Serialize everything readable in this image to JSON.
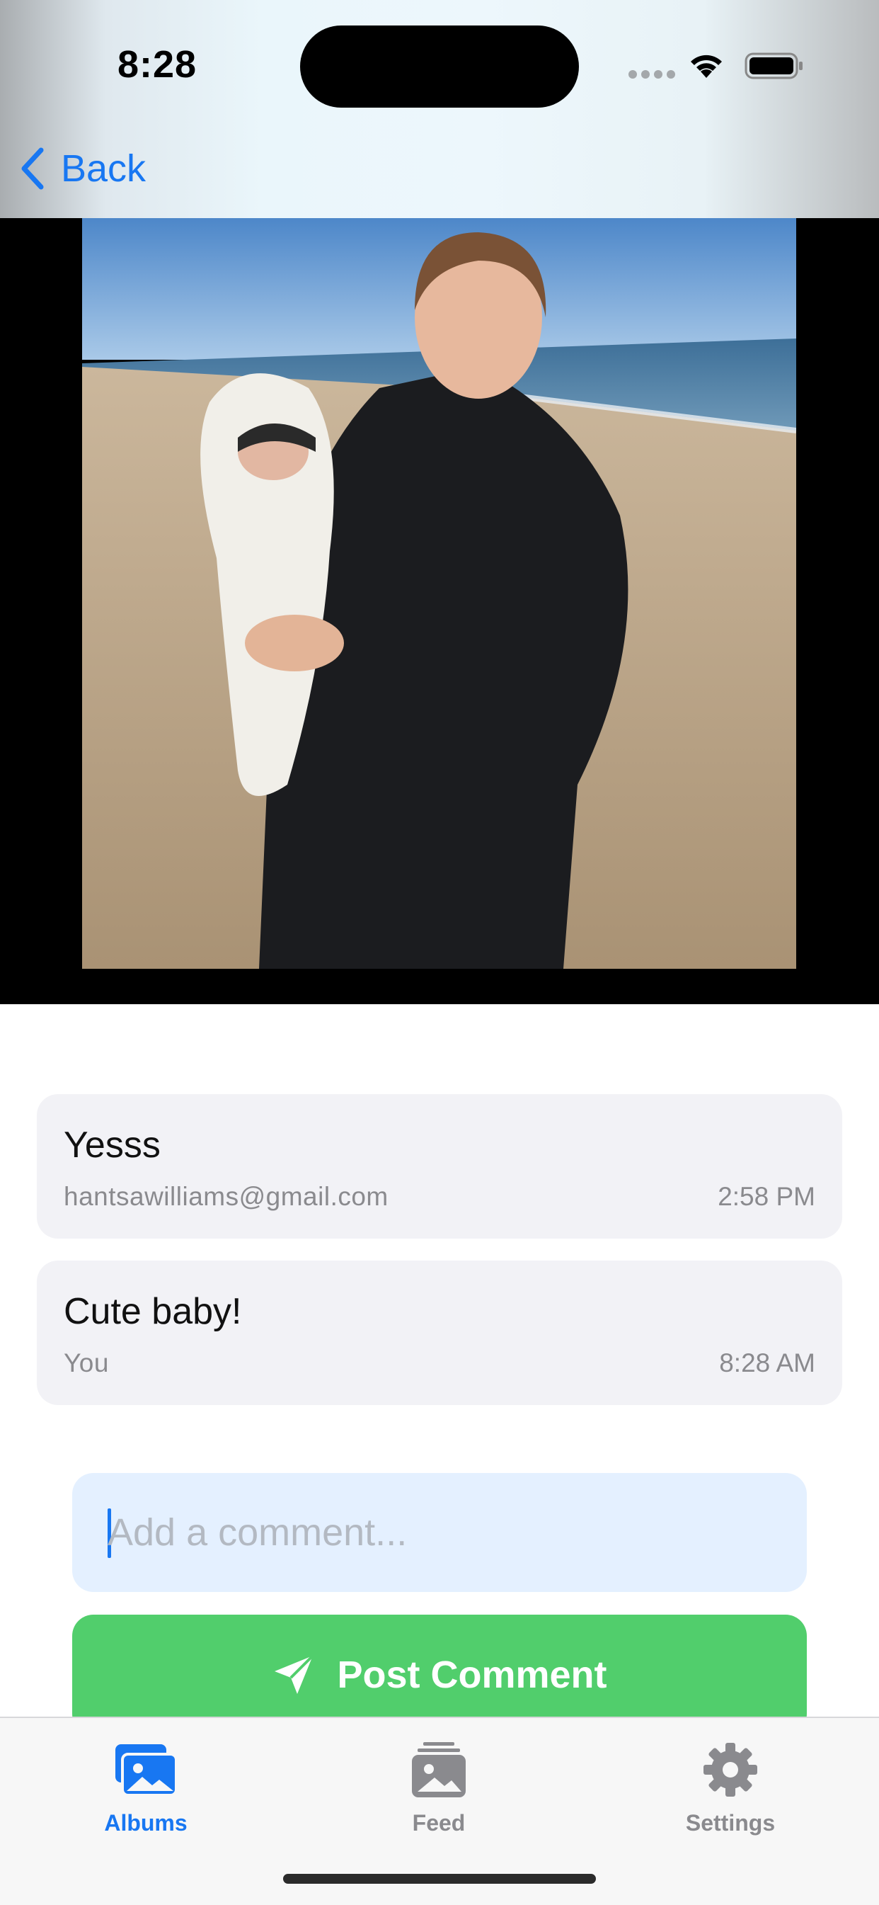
{
  "status_bar": {
    "time": "8:28"
  },
  "nav": {
    "back_label": "Back"
  },
  "comments": [
    {
      "text": "Yesss",
      "author": "hantsawilliams@gmail.com",
      "time": "2:58 PM"
    },
    {
      "text": "Cute baby!",
      "author": "You",
      "time": "8:28 AM"
    }
  ],
  "composer": {
    "placeholder": "Add a comment...",
    "value": "",
    "post_label": "Post Comment"
  },
  "tabbar": {
    "items": [
      {
        "label": "Albums",
        "icon": "albums-icon",
        "selected": true
      },
      {
        "label": "Feed",
        "icon": "feed-icon",
        "selected": false
      },
      {
        "label": "Settings",
        "icon": "gear-icon",
        "selected": false
      }
    ]
  },
  "colors": {
    "accent": "#1877f2",
    "post_button": "#51ce6c",
    "comment_bg": "#f2f2f6",
    "input_bg": "#e4f0ff"
  }
}
